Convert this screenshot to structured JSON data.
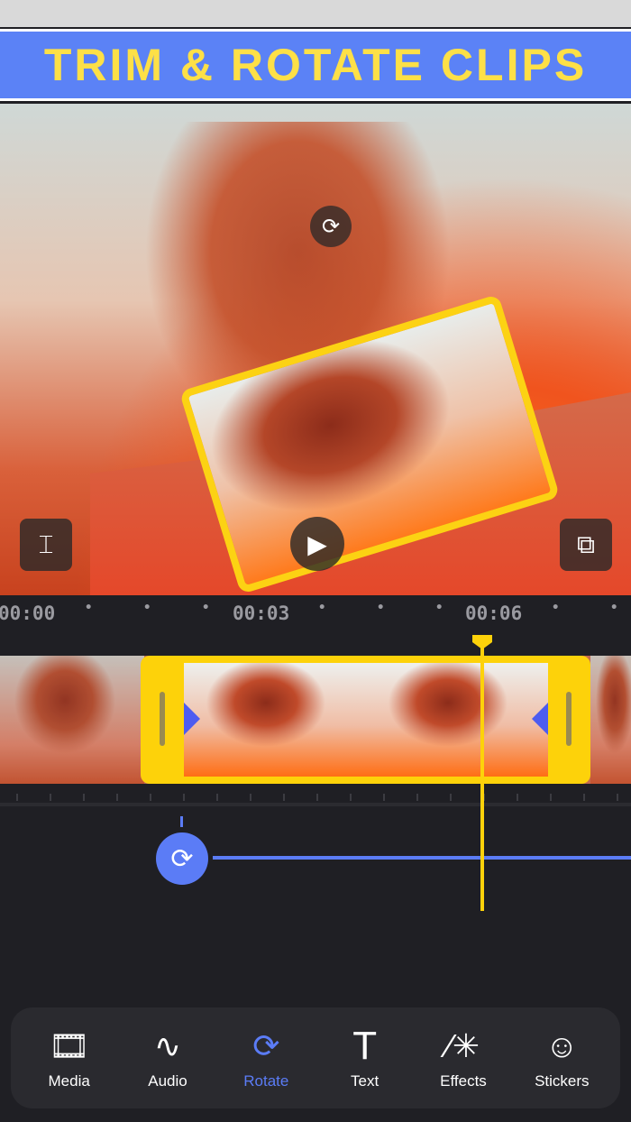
{
  "banner": {
    "title": "TRIM & ROTATE CLIPS"
  },
  "timeline": {
    "times": [
      "00:00",
      "00:03",
      "00:06"
    ]
  },
  "toolbar": {
    "items": [
      {
        "label": "Media",
        "icon": "media-icon"
      },
      {
        "label": "Audio",
        "icon": "waveform-icon"
      },
      {
        "label": "Rotate",
        "icon": "rotate-icon",
        "active": true
      },
      {
        "label": "Text",
        "icon": "text-icon"
      },
      {
        "label": "Effects",
        "icon": "magic-wand-icon"
      },
      {
        "label": "Stickers",
        "icon": "sticker-icon"
      }
    ]
  },
  "colors": {
    "accent": "#5b7cf6",
    "highlight": "#fdd20a",
    "banner": "#5b82f6",
    "banner_text": "#fde047"
  }
}
